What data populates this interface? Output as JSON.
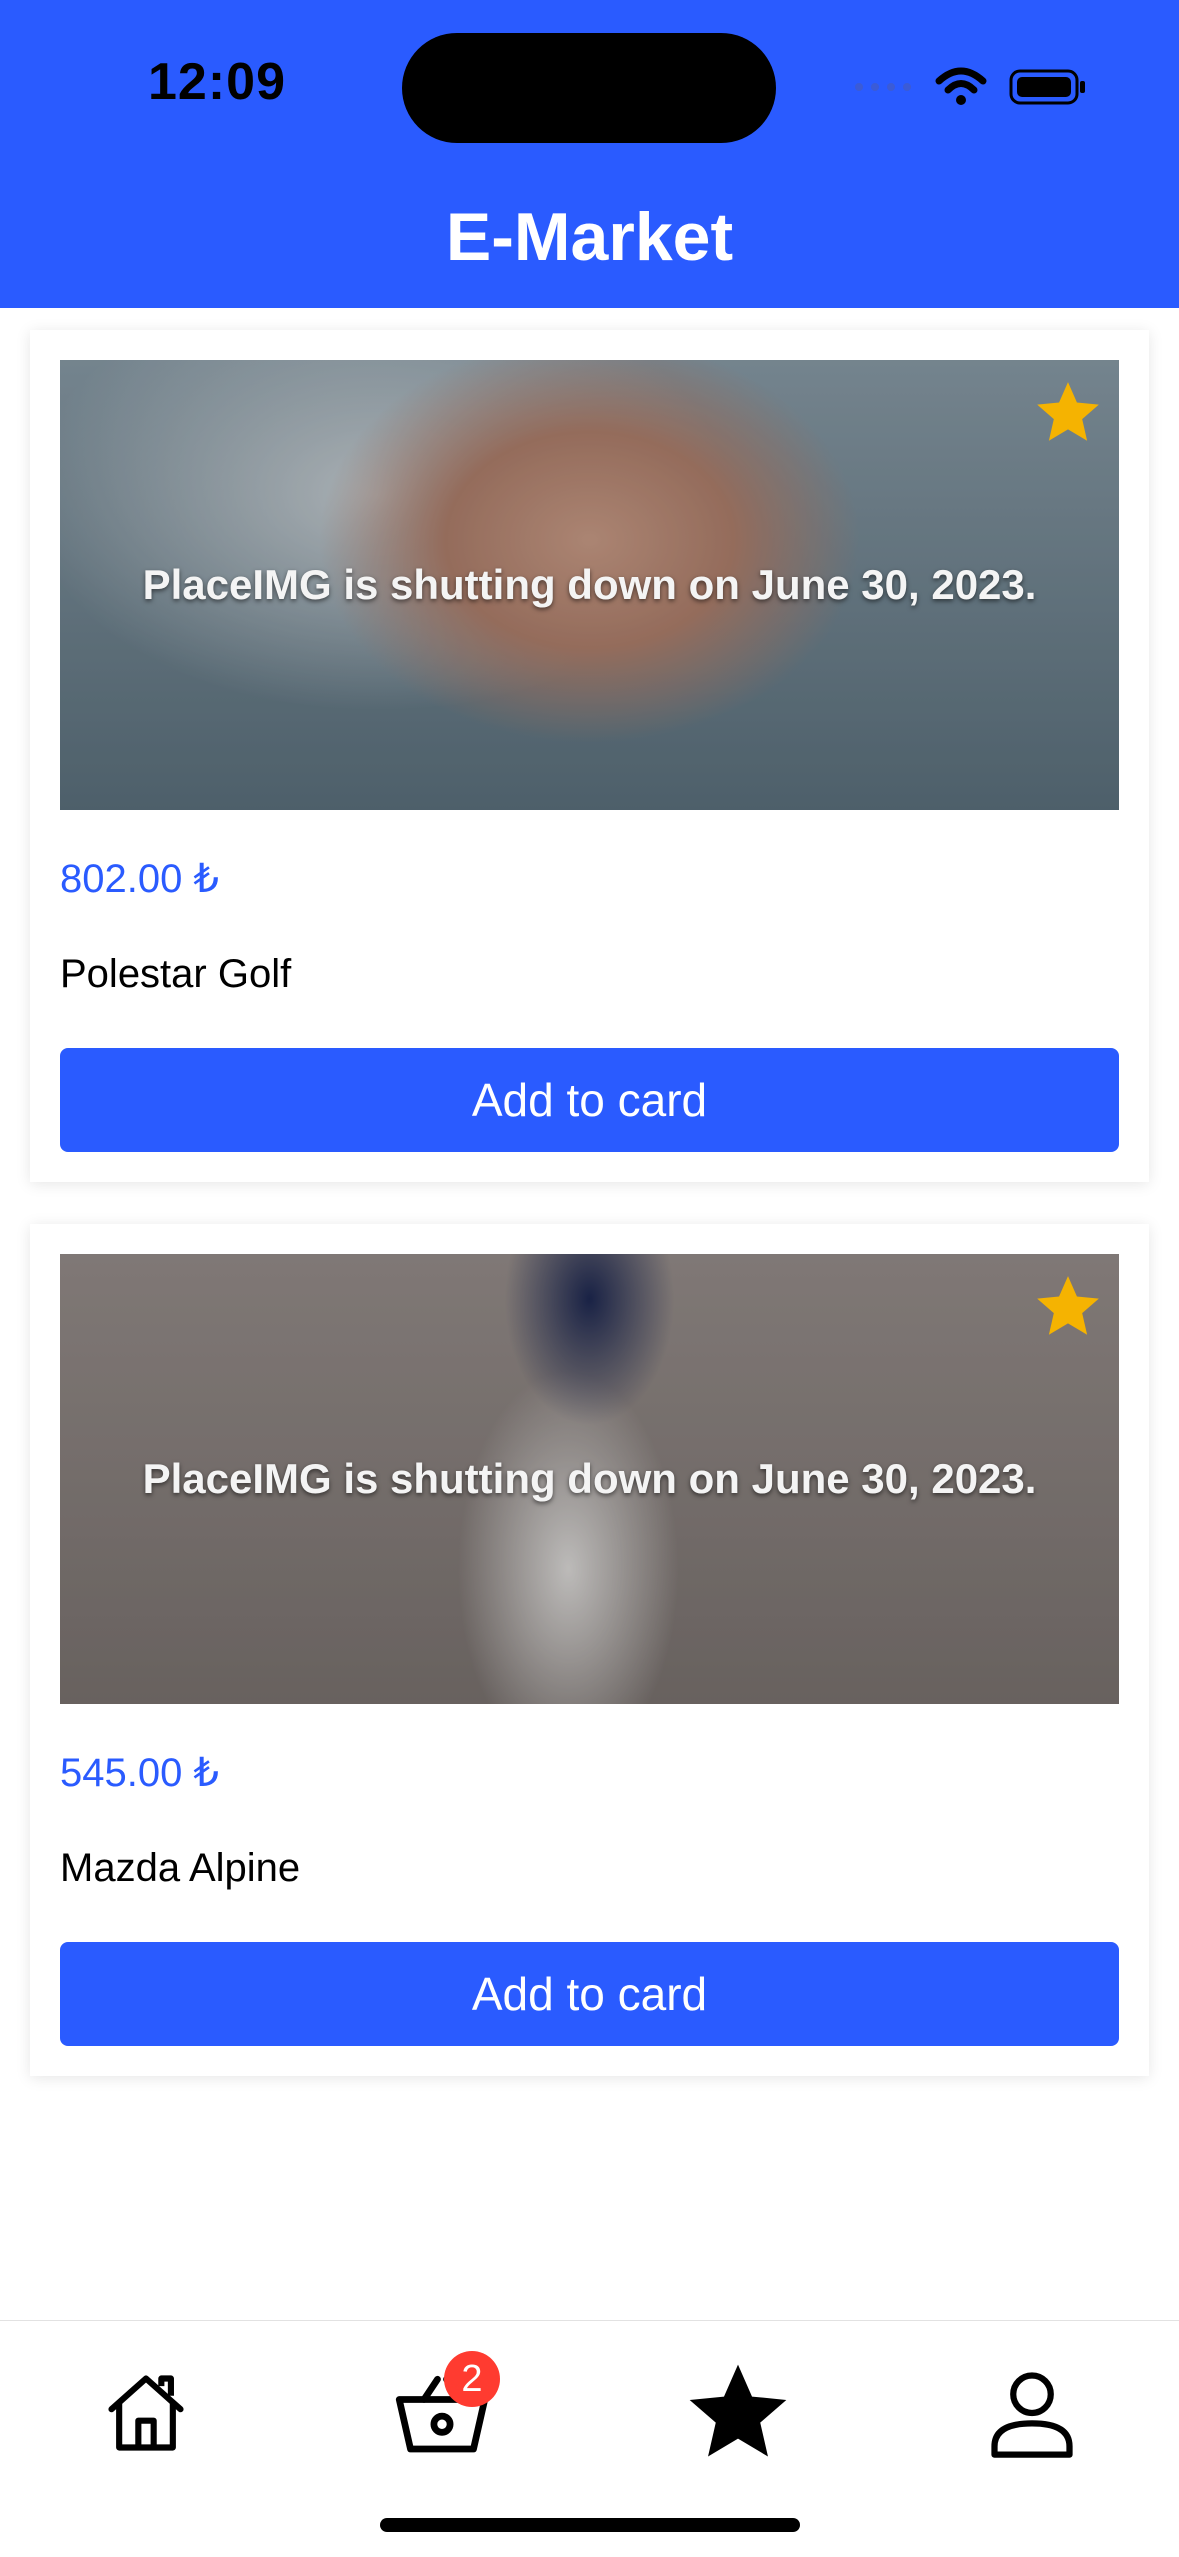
{
  "status_bar": {
    "time": "12:09"
  },
  "header": {
    "title": "E-Market"
  },
  "products": [
    {
      "image_notice": "PlaceIMG is shutting down on June 30, 2023.",
      "price": "802.00 ₺",
      "name": "Polestar Golf",
      "button_label": "Add to card",
      "favorite_icon": "star-icon"
    },
    {
      "image_notice": "PlaceIMG is shutting down on June 30, 2023.",
      "price": "545.00 ₺",
      "name": "Mazda Alpine",
      "button_label": "Add to card",
      "favorite_icon": "star-icon"
    }
  ],
  "tab_bar": {
    "items": [
      {
        "icon": "home-icon"
      },
      {
        "icon": "basket-icon",
        "badge": "2"
      },
      {
        "icon": "star-icon"
      },
      {
        "icon": "user-icon"
      }
    ]
  },
  "colors": {
    "primary": "#2a5bff",
    "favorite": "#f5b301",
    "badge": "#ff3b30"
  }
}
